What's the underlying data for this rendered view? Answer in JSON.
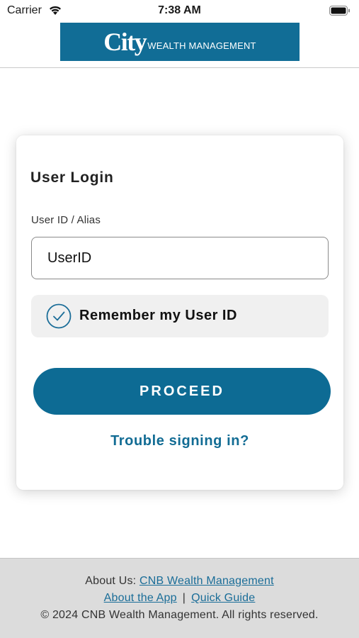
{
  "status_bar": {
    "carrier": "Carrier",
    "time": "7:38 AM",
    "wifi_icon": "wifi-icon",
    "battery_icon": "battery-icon"
  },
  "header": {
    "logo_main": "City",
    "logo_sub": "WEALTH MANAGEMENT",
    "logo_color": "#116d96"
  },
  "login": {
    "title": "User Login",
    "userid_label": "User ID / Alias",
    "userid_value": "UserID",
    "userid_placeholder": "",
    "remember_label": "Remember my User ID",
    "remember_checked": true,
    "proceed_label": "PROCEED",
    "trouble_label": "Trouble signing in?",
    "accent_color": "#0d6b94"
  },
  "footer": {
    "about_prefix": "About Us: ",
    "about_link": "CNB Wealth Management",
    "about_app": "About the App",
    "separator": "|",
    "quick_guide": "Quick Guide",
    "copyright": "© 2024 CNB Wealth Management. All rights reserved."
  }
}
